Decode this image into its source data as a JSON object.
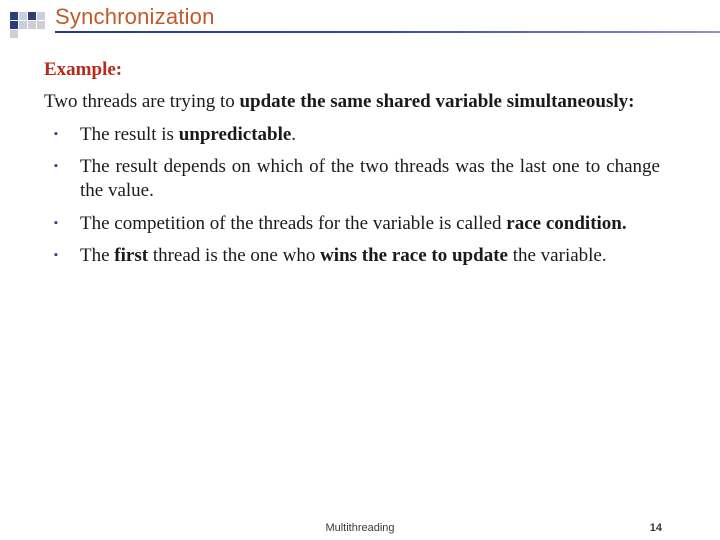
{
  "header": {
    "title": "Synchronization"
  },
  "content": {
    "example_label": "Example:",
    "intro_pre": "Two threads are trying to ",
    "intro_bold": "update the same shared variable simultaneously:",
    "bullets": [
      {
        "pre": "The result is ",
        "bold": "unpredictable",
        "post": "."
      },
      {
        "full": "The result depends on which of the two threads was the last one to change the value."
      },
      {
        "pre": "The competition of the threads for the variable is called ",
        "bold": "race condition."
      },
      {
        "p1": "The ",
        "b1": "first",
        "p2": " thread is the one who ",
        "b2": "wins the race to update",
        "p3": " the variable."
      }
    ]
  },
  "footer": {
    "title": "Multithreading",
    "page": "14"
  }
}
